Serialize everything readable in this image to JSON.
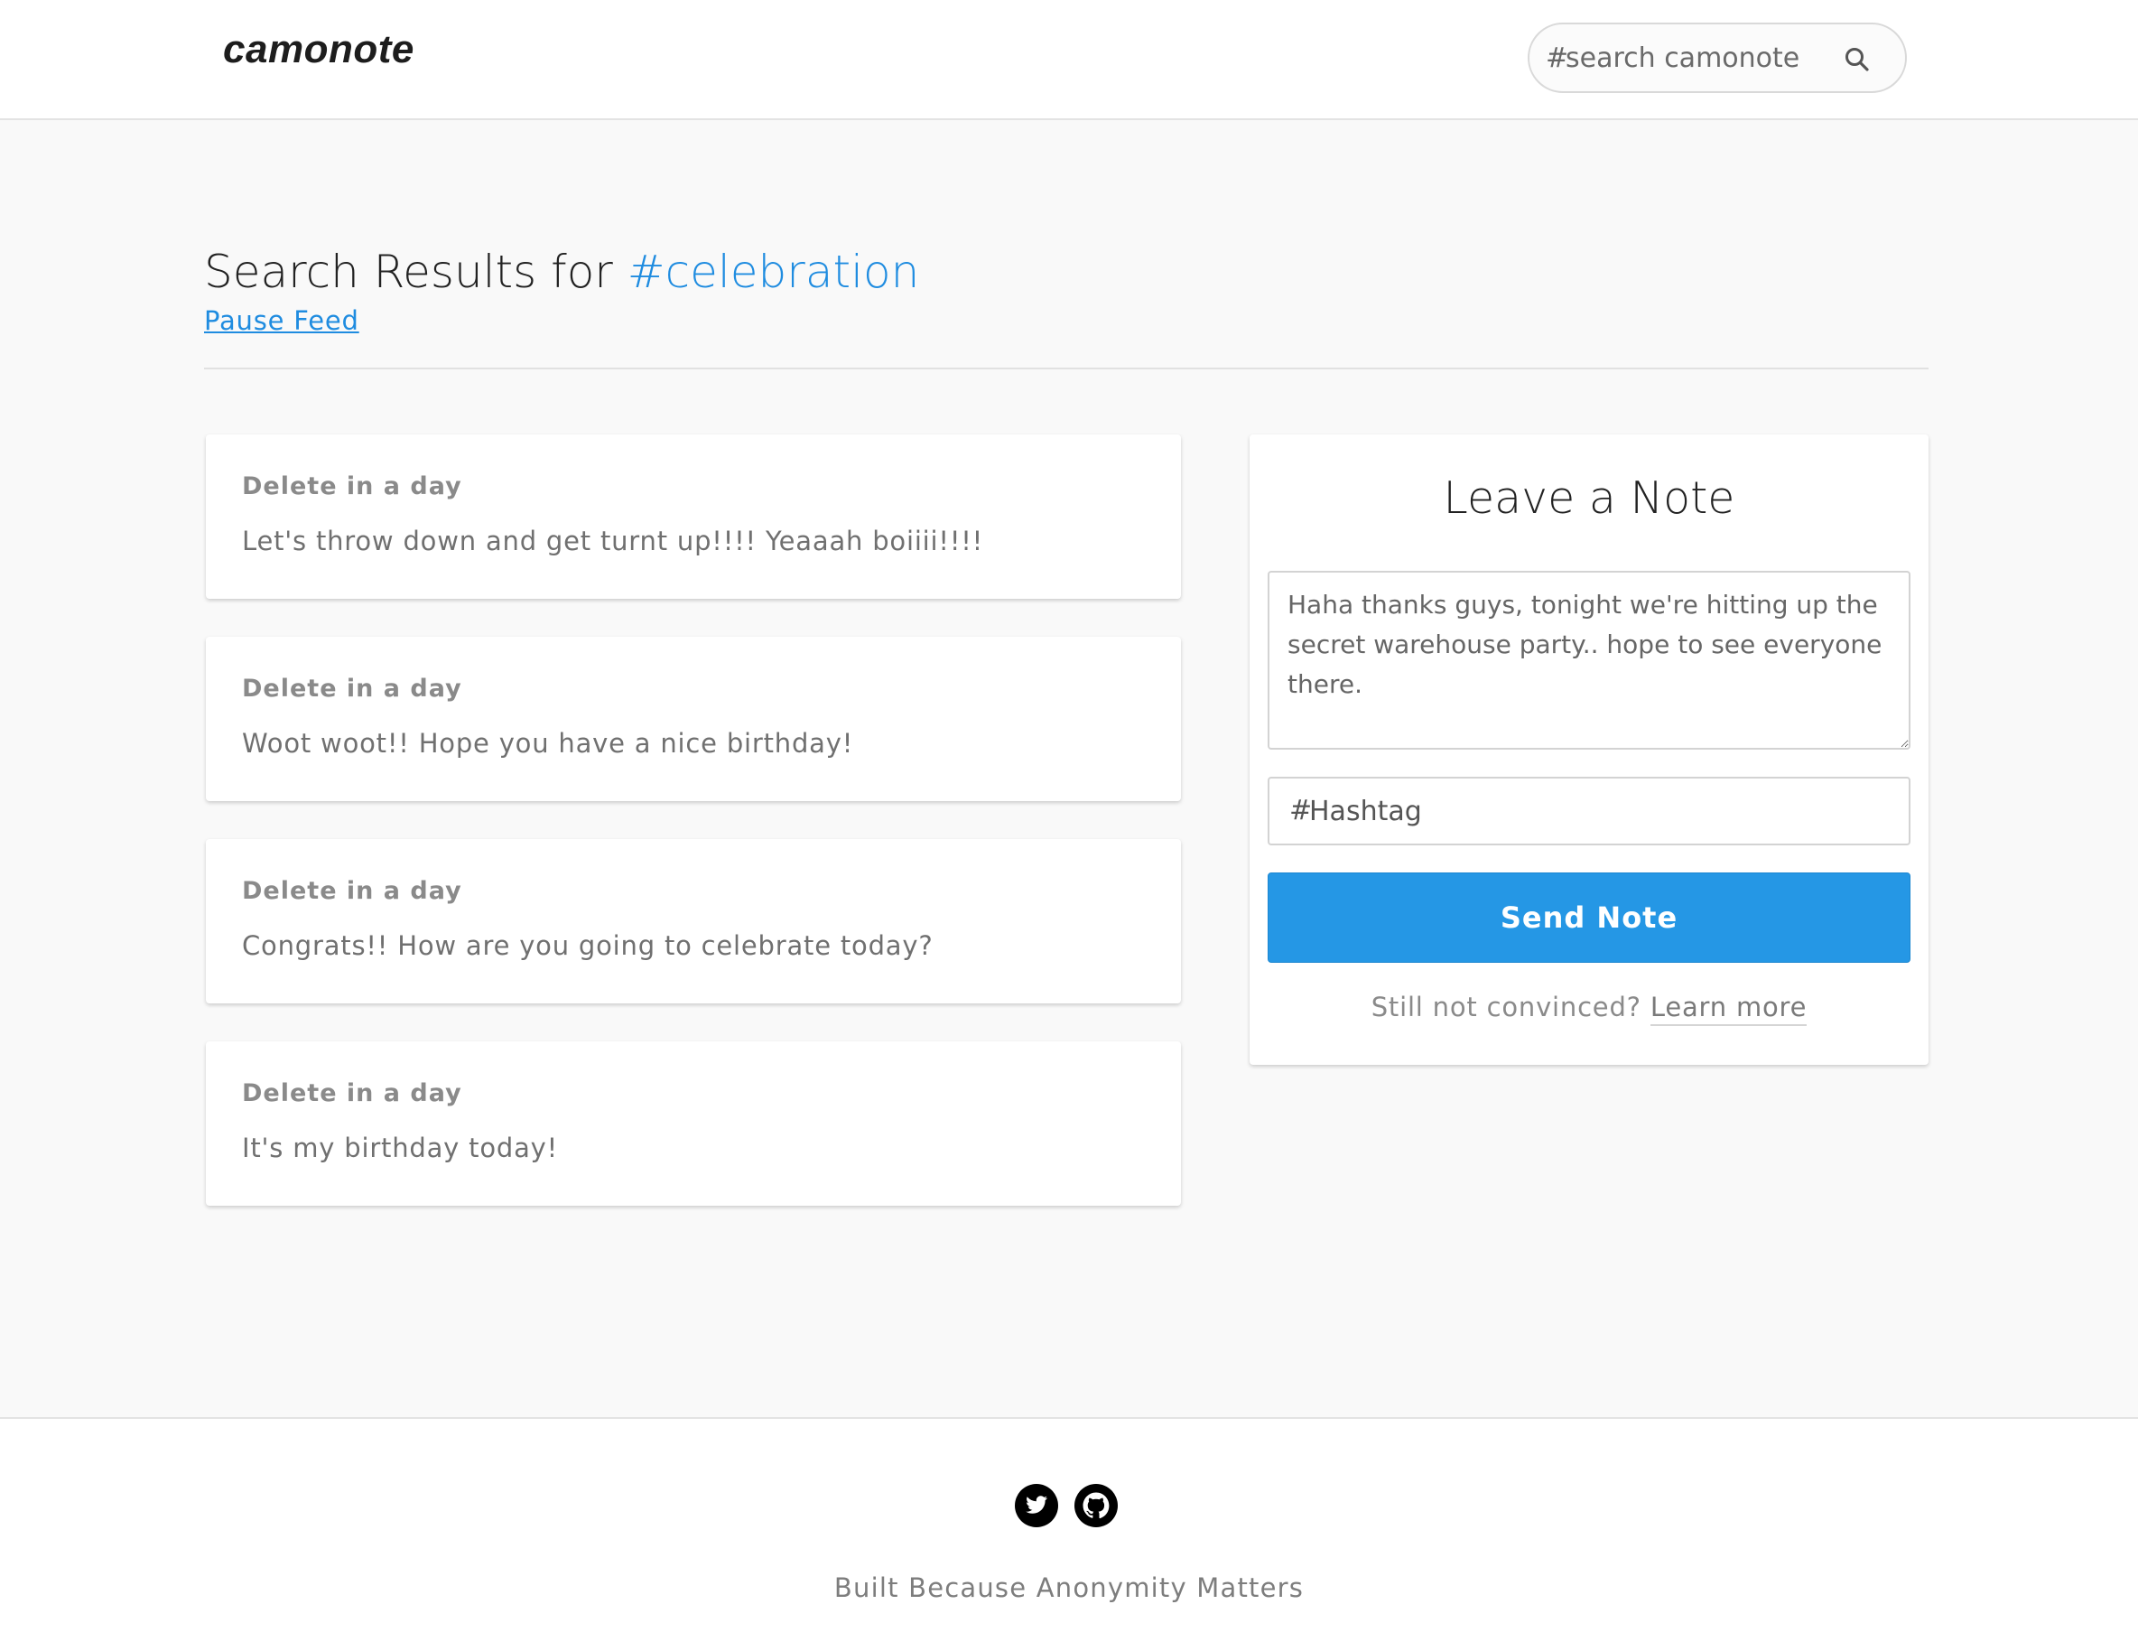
{
  "header": {
    "logo": "camonote",
    "search": {
      "hash": "#",
      "placeholder": "search camonote"
    }
  },
  "results": {
    "title_prefix": "Search Results for ",
    "tag": "#celebration",
    "pause_feed": "Pause Feed"
  },
  "notes": [
    {
      "meta": "Delete in a day",
      "body": "Let's throw down and get turnt up!!!! Yeaaah boiiii!!!!"
    },
    {
      "meta": "Delete in a day",
      "body": "Woot woot!! Hope you have a nice birthday!"
    },
    {
      "meta": "Delete in a day",
      "body": "Congrats!! How are you going to celebrate today?"
    },
    {
      "meta": "Delete in a day",
      "body": "It's my birthday today!"
    }
  ],
  "compose": {
    "title": "Leave a Note",
    "note_text": "Haha thanks guys, tonight we're hitting up the secret warehouse party.. hope to see everyone there.",
    "hashtag_hash": "#",
    "hashtag_placeholder": "Hashtag",
    "send_label": "Send Note",
    "learn_prefix": "Still not convinced? ",
    "learn_link": "Learn more"
  },
  "footer": {
    "icons": [
      "twitter-icon",
      "github-icon"
    ],
    "tagline": "Built Because Anonymity Matters"
  },
  "colors": {
    "accent": "#2597e5",
    "link": "#1f8ce0",
    "background": "#f9f9f9"
  }
}
